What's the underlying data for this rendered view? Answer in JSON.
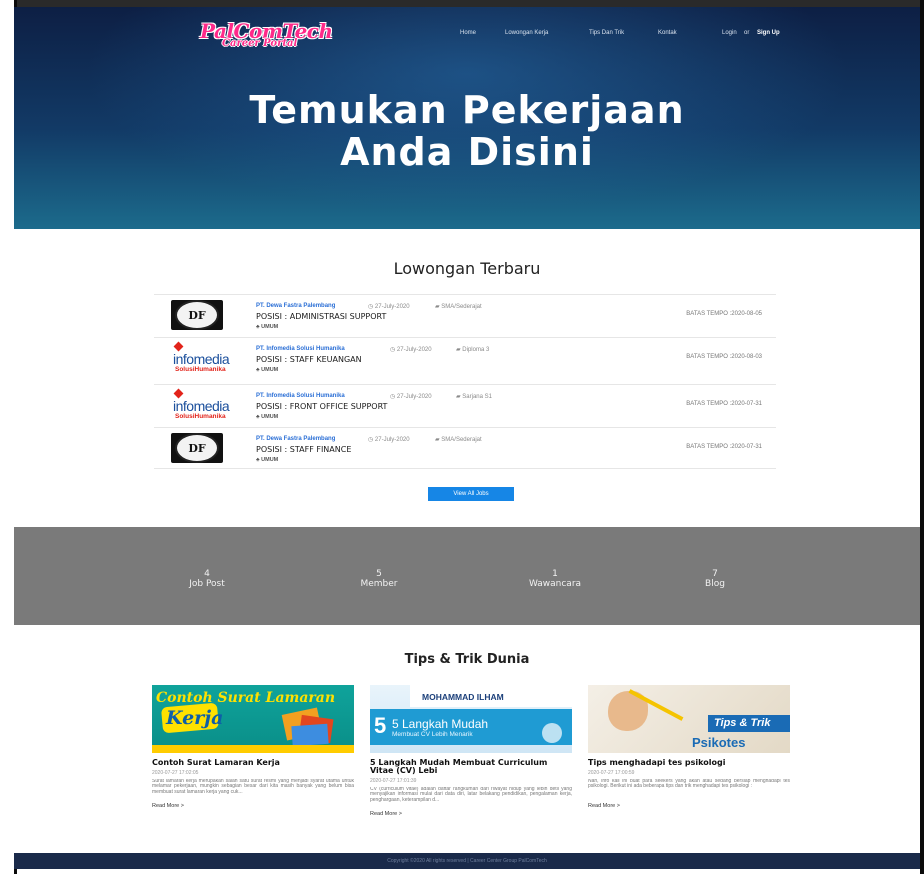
{
  "header": {
    "logo_main": "PalComTech",
    "logo_sub": "Career Portal",
    "nav": [
      "Home",
      "Lowongan Kerja",
      "Tips Dan Trik",
      "Kontak"
    ],
    "login": "Login",
    "or": "or",
    "signup": "Sign Up"
  },
  "hero": {
    "title_line1": "Temukan Pekerjaan",
    "title_line2": "Anda Disini"
  },
  "jobs": {
    "title": "Lowongan Terbaru",
    "items": [
      {
        "company": "PT. Dewa Fastra Palembang",
        "date": "27-July-2020",
        "education": "SMA/Sederajat",
        "position": "POSISI : ADMINISTRASI SUPPORT",
        "category": "UMUM",
        "deadline": "BATAS TEMPO :2020-08-05",
        "logo": "seal"
      },
      {
        "company": "PT. Infomedia Solusi Humanika",
        "date": "27-July-2020",
        "education": "Diploma 3",
        "position": "POSISI : STAFF KEUANGAN",
        "category": "UMUM",
        "deadline": "BATAS TEMPO :2020-08-03",
        "logo": "infomedia"
      },
      {
        "company": "PT. Infomedia Solusi Humanika",
        "date": "27-July-2020",
        "education": "Sarjana S1",
        "position": "POSISI : FRONT OFFICE SUPPORT",
        "category": "UMUM",
        "deadline": "BATAS TEMPO :2020-07-31",
        "logo": "infomedia"
      },
      {
        "company": "PT. Dewa Fastra Palembang",
        "date": "27-July-2020",
        "education": "SMA/Sederajat",
        "position": "POSISI : STAFF FINANCE",
        "category": "UMUM",
        "deadline": "BATAS TEMPO :2020-07-31",
        "logo": "seal"
      }
    ],
    "view_all": "View All Jobs",
    "infomedia_name": "infomedia",
    "infomedia_tag": "SolusiHumanika",
    "seal_text": "DF"
  },
  "stats": [
    {
      "value": "4",
      "label": "Job Post"
    },
    {
      "value": "5",
      "label": "Member"
    },
    {
      "value": "1",
      "label": "Wawancara"
    },
    {
      "value": "7",
      "label": "Blog"
    }
  ],
  "tips": {
    "title": "Tips & Trik Dunia",
    "cards": [
      {
        "img_line1": "Contoh Surat Lamaran",
        "img_line2": "Kerja",
        "title": "Contoh Surat Lamaran Kerja",
        "date": "2020-07-27 17:02:05",
        "text": "Surat lamaran kerja merupakan salah satu surat resmi yang menjadi syarat utama untuk melamar pekerjaan, mungkin sebagian besar dari kita masih banyak yang belum bisa membuat surat lamaran kerja yang cuk...",
        "more": "Read More >"
      },
      {
        "img_name": "MOHAMMAD ILHAM",
        "img_line1": "5 Langkah Mudah",
        "img_line2": "Membuat CV Lebih Menarik",
        "title": "5 Langkah Mudah Membuat Curriculum Vitae (CV) Lebi",
        "date": "2020-07-27 17:01:39",
        "text": "CV (curriculum vitae) adalah daftar rangkuman dari riwayat hidup yang lebih detil yang menyajikan informasi mulai dari data diri, latar belakang pendidikan, pengalaman kerja, penghargaan, keterampilan d...",
        "more": "Read More >"
      },
      {
        "img_line1": "Tips & Trik",
        "img_line2": "Psikotes",
        "title": "Tips menghadapi tes psikologi",
        "date": "2020-07-27 17:00:59",
        "text": "Nah, info kali ini buat para seekers yang akan atau sedang bersiap menghadapi tes psikologi. Berikut ini ada beberapa tips dan trik menghadapi tes psikologi :",
        "more": "Read More >"
      }
    ]
  },
  "footer": {
    "text": "Copyright ©2020 All rights reserved | Career Center Group PalComTech"
  },
  "colors": {
    "accent": "#1686e6",
    "logo": "#ff2a8a",
    "stats_bg": "#7a7a7a",
    "footer_bg": "#1a2a4a"
  }
}
